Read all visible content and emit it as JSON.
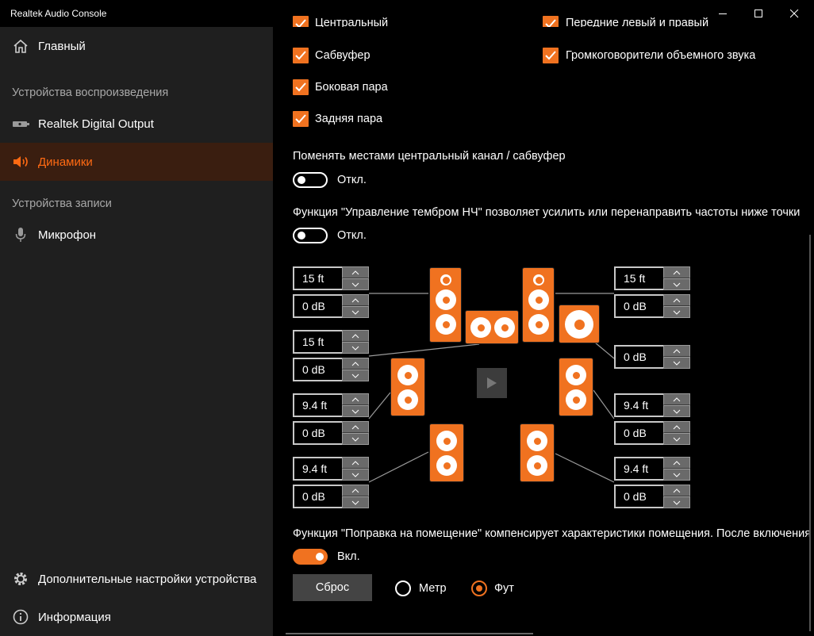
{
  "window": {
    "title": "Realtek Audio Console"
  },
  "sidebar": {
    "home": "Главный",
    "playback_section": "Устройства воспроизведения",
    "digital_output": "Realtek Digital Output",
    "speakers": "Динамики",
    "recording_section": "Устройства записи",
    "microphone": "Микрофон",
    "advanced": "Дополнительные настройки устройства",
    "info": "Информация"
  },
  "checkboxes": {
    "center": "Центральный",
    "front_lr": "Передние левый и правый",
    "subwoofer": "Сабвуфер",
    "surround": "Громкоговорители объемного звука",
    "side_pair": "Боковая пара",
    "rear_pair": "Задняя пара"
  },
  "swap": {
    "label": "Поменять местами центральный канал / сабвуфер",
    "state": "Откл."
  },
  "bass": {
    "label": "Функция \"Управление тембром НЧ\" позволяет усилить или перенаправить частоты ниже точки",
    "state": "Откл."
  },
  "room": {
    "label": "Функция \"Поправка на помещение\" компенсирует характеристики помещения. После включения",
    "state": "Вкл."
  },
  "speaker_settings": {
    "front_left_distance": "15 ft",
    "front_left_gain": "0 dB",
    "center_distance": "15 ft",
    "center_gain": "0 dB",
    "side_left_distance": "9.4 ft",
    "side_left_gain": "0 dB",
    "rear_left_distance": "9.4 ft",
    "rear_left_gain": "0 dB",
    "front_right_distance": "15 ft",
    "front_right_gain": "0 dB",
    "sub_gain": "0 dB",
    "side_right_distance": "9.4 ft",
    "side_right_gain": "0 dB",
    "rear_right_distance": "9.4 ft",
    "rear_right_gain": "0 dB"
  },
  "units": {
    "reset": "Сброс",
    "meter": "Метр",
    "feet": "Фут",
    "selected": "feet"
  },
  "colors": {
    "accent": "#f07220",
    "sidebar_bg": "#1f1f1f",
    "active_bg": "#3a1e10"
  }
}
